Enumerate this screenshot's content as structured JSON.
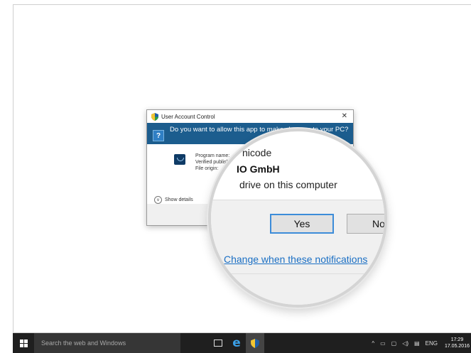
{
  "dialog": {
    "title": "User Account Control",
    "close_glyph": "✕",
    "question": "Do you want to allow this app to make changes to your PC?",
    "program_name_label": "Program name:",
    "verified_publisher_label": "Verified publisher:",
    "file_origin_label": "File origin:",
    "show_details": "Show details"
  },
  "magnifier": {
    "line1": "nicode",
    "line2": "IO GmbH",
    "line3": "drive on this computer",
    "yes_label": "Yes",
    "no_label": "No",
    "link_text": "Change when these notifications"
  },
  "taskbar": {
    "search_placeholder": "Search the web and Windows",
    "language": "ENG",
    "time": "17:29",
    "date": "17.05.2016",
    "edge_glyph": "e",
    "tray_chevron": "^"
  },
  "colors": {
    "banner": "#1c5d8e",
    "accent": "#3c8cd9",
    "taskbar": "#1f1f1f"
  }
}
